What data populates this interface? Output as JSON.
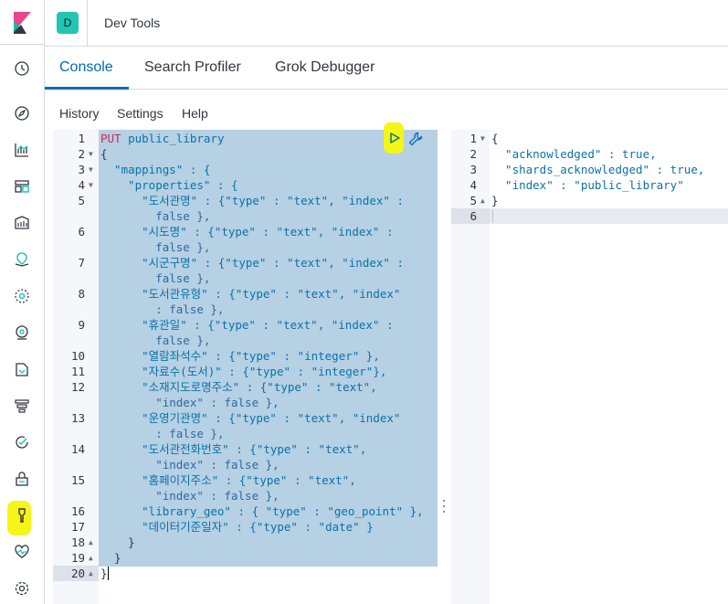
{
  "header": {
    "avatar_letter": "D",
    "title": "Dev Tools"
  },
  "tabs": [
    {
      "label": "Console",
      "active": true
    },
    {
      "label": "Search Profiler",
      "active": false
    },
    {
      "label": "Grok Debugger",
      "active": false
    }
  ],
  "submenu": {
    "history": "History",
    "settings": "Settings",
    "help": "Help"
  },
  "request": {
    "line_numbers": [
      "1",
      "2",
      "3",
      "4",
      "5",
      "6",
      "7",
      "8",
      "9",
      "10",
      "11",
      "12",
      "13",
      "14",
      "15",
      "16",
      "17",
      "18",
      "19",
      "20"
    ],
    "method": "PUT",
    "path": "public_library",
    "lines": {
      "l2": "{",
      "l3": "  \"mappings\" : {",
      "l4": "    \"properties\" : {",
      "l5a": "      \"도서관명\" : {\"type\" : \"text\", \"index\" :",
      "l5b": "        false },",
      "l6a": "      \"시도명\" : {\"type\" : \"text\", \"index\" :",
      "l6b": "        false },",
      "l7a": "      \"시군구명\" : {\"type\" : \"text\", \"index\" :",
      "l7b": "        false },",
      "l8a": "      \"도서관유형\" : {\"type\" : \"text\", \"index\"",
      "l8b": "        : false },",
      "l9a": "      \"휴관일\" : {\"type\" : \"text\", \"index\" :",
      "l9b": "        false },",
      "l10": "      \"열람좌석수\" : {\"type\" : \"integer\" },",
      "l11": "      \"자료수(도서)\" : {\"type\" : \"integer\"},",
      "l12a": "      \"소재지도로명주소\" : {\"type\" : \"text\",",
      "l12b": "        \"index\" : false },",
      "l13a": "      \"운영기관명\" : {\"type\" : \"text\", \"index\"",
      "l13b": "        : false },",
      "l14a": "      \"도서관전화번호\" : {\"type\" : \"text\",",
      "l14b": "        \"index\" : false },",
      "l15a": "      \"홈페이지주소\" : {\"type\" : \"text\",",
      "l15b": "        \"index\" : false },",
      "l16": "      \"library_geo\" : { \"type\" : \"geo_point\" },",
      "l17": "      \"데이터기준일자\" : {\"type\" : \"date\" }",
      "l18": "    }",
      "l19": "  }",
      "l20": "}"
    }
  },
  "response": {
    "line_numbers": [
      "1",
      "2",
      "3",
      "4",
      "5",
      "6"
    ],
    "lines": {
      "l1": "{",
      "l2": "  \"acknowledged\" : true,",
      "l3": "  \"shards_acknowledged\" : true,",
      "l4": "  \"index\" : \"public_library\"",
      "l5": "}",
      "l6": ""
    }
  },
  "icons": {
    "nav": [
      "logo-icon",
      "clock-icon",
      "compass-icon",
      "visualize-icon",
      "dashboard-icon",
      "canvas-icon",
      "maps-icon",
      "ml-icon",
      "metrics-icon",
      "logs-icon",
      "apm-icon",
      "uptime-icon",
      "security-icon",
      "dev-tools-icon",
      "monitoring-icon",
      "management-icon"
    ],
    "actions": [
      "play-icon",
      "wrench-icon"
    ]
  },
  "colors": {
    "accent": "#006bb8",
    "avatar": "#20c5b4",
    "selection": "#b6d0e4",
    "highlight": "#f5f518",
    "method": "#c92a57",
    "string": "#0a73a8"
  }
}
